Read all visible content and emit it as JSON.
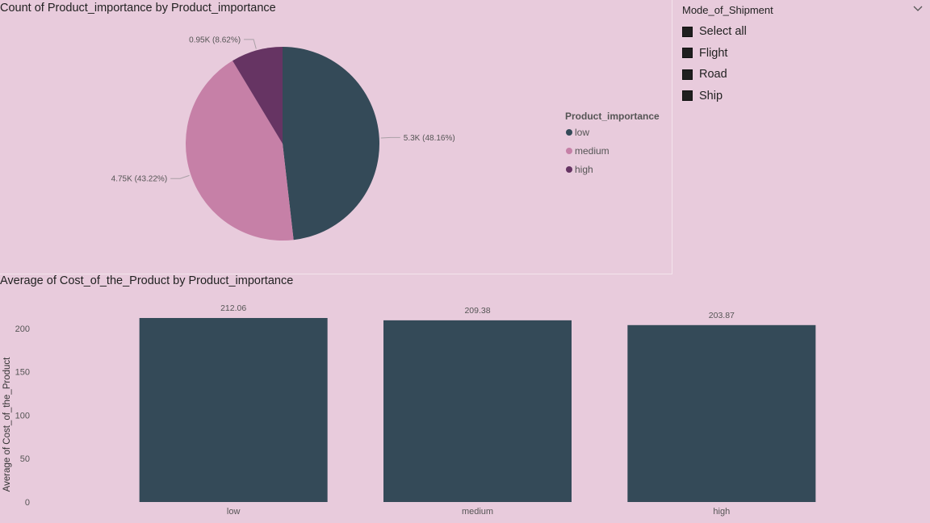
{
  "colors": {
    "low": "#344a58",
    "medium": "#c680a7",
    "high": "#663463",
    "background": "#e8cbdc"
  },
  "pie_visual": {
    "title": "Count of Product_importance by Product_importance"
  },
  "bar_visual": {
    "title": "Average of Cost_of_the_Product by Product_importance"
  },
  "slicer": {
    "title": "Mode_of_Shipment",
    "items": [
      {
        "label": "Select all"
      },
      {
        "label": "Flight"
      },
      {
        "label": "Road"
      },
      {
        "label": "Ship"
      }
    ]
  },
  "chart_data": [
    {
      "type": "pie",
      "title": "Count of Product_importance by Product_importance",
      "legend_title": "Product_importance",
      "legend_position": "right",
      "categories": [
        "low",
        "medium",
        "high"
      ],
      "values": [
        5300,
        4750,
        950
      ],
      "percentages": [
        48.16,
        43.22,
        8.62
      ],
      "data_labels": [
        "5.3K (48.16%)",
        "4.75K (43.22%)",
        "0.95K (8.62%)"
      ],
      "colors": [
        "#344a58",
        "#c680a7",
        "#663463"
      ]
    },
    {
      "type": "bar",
      "title": "Average of Cost_of_the_Product by Product_importance",
      "categories": [
        "low",
        "medium",
        "high"
      ],
      "values": [
        212.06,
        209.38,
        203.87
      ],
      "data_labels": [
        "212.06",
        "209.38",
        "203.87"
      ],
      "ylabel": "Average of Cost_of_the_Product",
      "yticks": [
        0,
        50,
        100,
        150,
        200
      ],
      "ylim": [
        0,
        212.06
      ],
      "color": "#344a58"
    }
  ]
}
